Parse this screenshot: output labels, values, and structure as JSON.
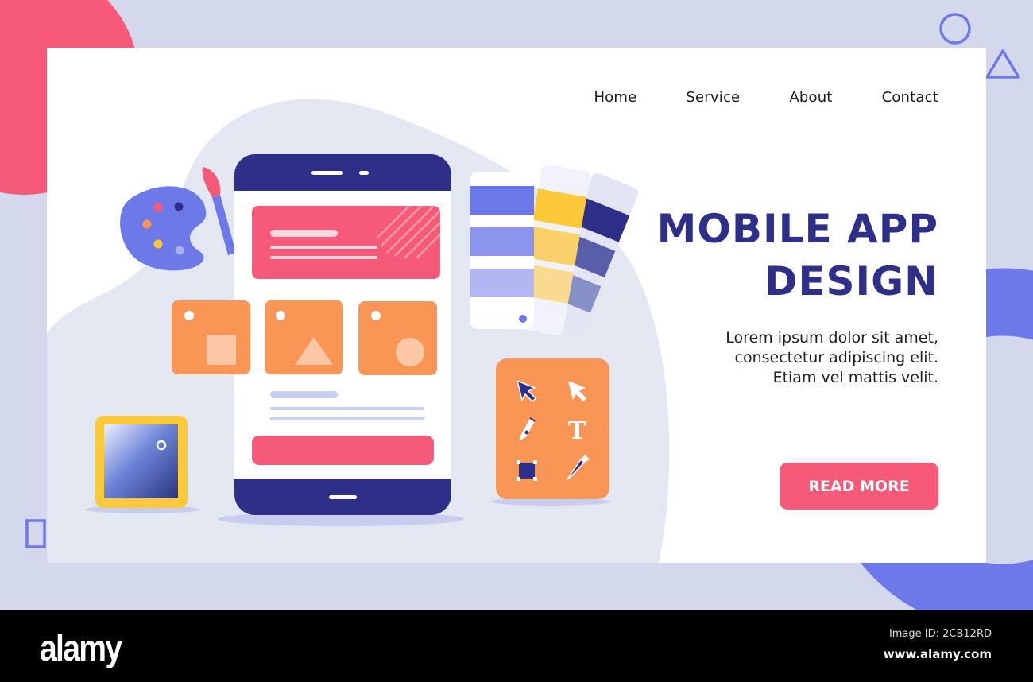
{
  "nav": {
    "items": [
      {
        "label": "Home"
      },
      {
        "label": "Service"
      },
      {
        "label": "About"
      },
      {
        "label": "Contact"
      }
    ]
  },
  "hero": {
    "title_line1": "MOBILE APP",
    "title_line2": "DESIGN",
    "description_line1": "Lorem ipsum dolor sit amet,",
    "description_line2": "consectetur adipiscing elit.",
    "description_line3": "Etiam vel mattis velit.",
    "cta_label": "READ MORE"
  },
  "illustration": {
    "phone_wireframe": "phone-wireframe",
    "tool_icons": [
      "cursor-filled-icon",
      "cursor-outline-icon",
      "pen-tool-icon",
      "text-tool-icon",
      "rectangle-tool-icon",
      "eyedropper-icon"
    ],
    "shape_cards": [
      "square",
      "triangle",
      "circle"
    ]
  },
  "colors": {
    "brand_navy": "#2e2f88",
    "accent_pink": "#f65a78",
    "accent_orange": "#f99655",
    "accent_yellow": "#fcc93a",
    "accent_periwinkle": "#6d79e8",
    "background": "#d3d8ec"
  },
  "footer": {
    "logo": "alamy",
    "image_id": "Image ID: 2CB12RD",
    "url": "www.alamy.com"
  }
}
